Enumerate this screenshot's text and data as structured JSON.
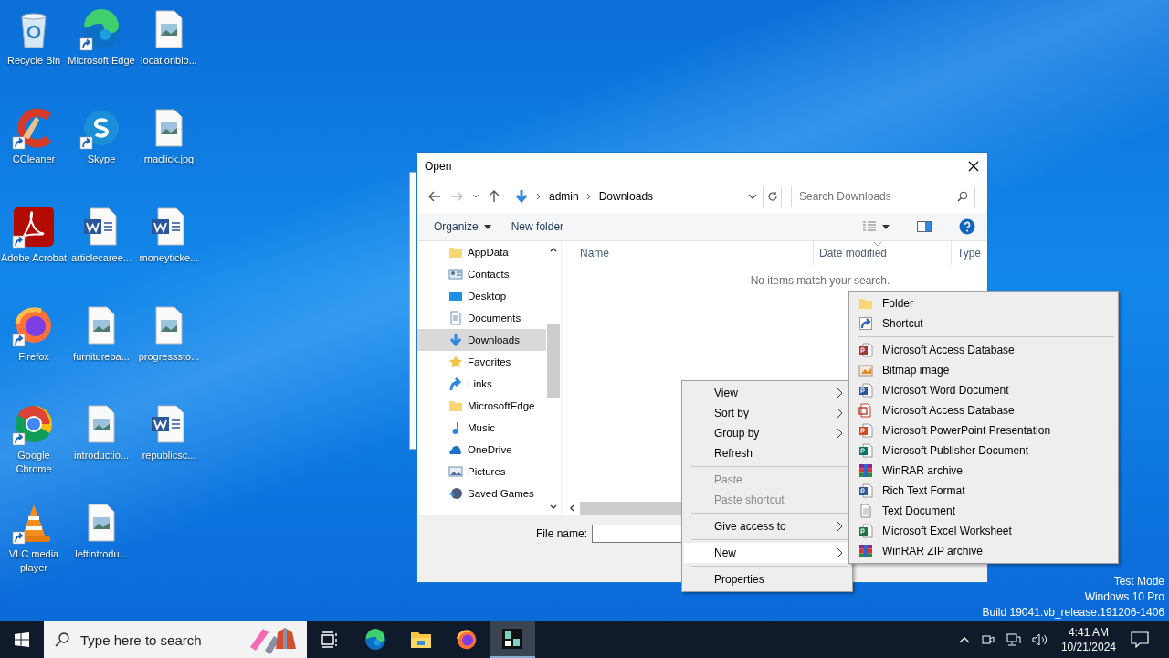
{
  "desktop": {
    "icons": [
      {
        "label": "Recycle Bin",
        "kind": "recycle",
        "shortcut": false
      },
      {
        "label": "Microsoft Edge",
        "kind": "edge",
        "shortcut": true
      },
      {
        "label": "locationblo...",
        "kind": "image",
        "shortcut": false
      },
      {
        "label": "CCleaner",
        "kind": "ccleaner",
        "shortcut": true
      },
      {
        "label": "Skype",
        "kind": "skype",
        "shortcut": true
      },
      {
        "label": "maclick.jpg",
        "kind": "image",
        "shortcut": false
      },
      {
        "label": "Adobe Acrobat",
        "kind": "pdf",
        "shortcut": true
      },
      {
        "label": "articlecaree...",
        "kind": "word",
        "shortcut": false
      },
      {
        "label": "moneyticke...",
        "kind": "word",
        "shortcut": false
      },
      {
        "label": "Firefox",
        "kind": "firefox",
        "shortcut": true
      },
      {
        "label": "furnitureba...",
        "kind": "image",
        "shortcut": false
      },
      {
        "label": "progresssto...",
        "kind": "image",
        "shortcut": false
      },
      {
        "label": "Google Chrome",
        "kind": "chrome",
        "shortcut": true
      },
      {
        "label": "introductio...",
        "kind": "image",
        "shortcut": false
      },
      {
        "label": "republicsc...",
        "kind": "word",
        "shortcut": false
      },
      {
        "label": "VLC media player",
        "kind": "vlc",
        "shortcut": true
      },
      {
        "label": "leftintrodu...",
        "kind": "image",
        "shortcut": false
      }
    ],
    "watermark": [
      "Test Mode",
      "Windows 10 Pro",
      "Build 19041.vb_release.191206-1406"
    ]
  },
  "dialog": {
    "title": "Open",
    "path": [
      "admin",
      "Downloads"
    ],
    "search": {
      "placeholder": "Search Downloads"
    },
    "toolbar": {
      "organize": "Organize",
      "new_folder": "New folder"
    },
    "nav_items": [
      {
        "label": "AppData",
        "kind": "folder",
        "selected": false
      },
      {
        "label": "Contacts",
        "kind": "contacts",
        "selected": false
      },
      {
        "label": "Desktop",
        "kind": "desktop",
        "selected": false
      },
      {
        "label": "Documents",
        "kind": "documents",
        "selected": false
      },
      {
        "label": "Downloads",
        "kind": "downloads",
        "selected": true
      },
      {
        "label": "Favorites",
        "kind": "star",
        "selected": false
      },
      {
        "label": "Links",
        "kind": "link",
        "selected": false
      },
      {
        "label": "MicrosoftEdge",
        "kind": "folder",
        "selected": false
      },
      {
        "label": "Music",
        "kind": "music",
        "selected": false
      },
      {
        "label": "OneDrive",
        "kind": "cloud",
        "selected": false
      },
      {
        "label": "Pictures",
        "kind": "pictures",
        "selected": false
      },
      {
        "label": "Saved Games",
        "kind": "games",
        "selected": false
      }
    ],
    "columns": [
      "Name",
      "Date modified",
      "Type"
    ],
    "empty_message": "No items match your search.",
    "file_name": {
      "label": "File name:"
    }
  },
  "context_menu": [
    {
      "kind": "item",
      "label": "View",
      "disabled": false,
      "submenu": true,
      "selected": false
    },
    {
      "kind": "item",
      "label": "Sort by",
      "disabled": false,
      "submenu": true,
      "selected": false
    },
    {
      "kind": "item",
      "label": "Group by",
      "disabled": false,
      "submenu": true,
      "selected": false
    },
    {
      "kind": "item",
      "label": "Refresh",
      "disabled": false,
      "submenu": false,
      "selected": false
    },
    {
      "kind": "separator"
    },
    {
      "kind": "item",
      "label": "Paste",
      "disabled": true,
      "submenu": false,
      "selected": false
    },
    {
      "kind": "item",
      "label": "Paste shortcut",
      "disabled": true,
      "submenu": false,
      "selected": false
    },
    {
      "kind": "separator"
    },
    {
      "kind": "item",
      "label": "Give access to",
      "disabled": false,
      "submenu": true,
      "selected": false
    },
    {
      "kind": "separator"
    },
    {
      "kind": "item",
      "label": "New",
      "disabled": false,
      "submenu": true,
      "selected": true
    },
    {
      "kind": "separator"
    },
    {
      "kind": "item",
      "label": "Properties",
      "disabled": false,
      "submenu": false,
      "selected": false
    }
  ],
  "new_submenu": [
    {
      "label": "Folder",
      "kind": "folder"
    },
    {
      "label": "Shortcut",
      "kind": "shortcut"
    },
    {
      "kind": "separator"
    },
    {
      "label": "Microsoft Access Database",
      "kind": "access"
    },
    {
      "label": "Bitmap image",
      "kind": "bitmap"
    },
    {
      "label": "Microsoft Word Document",
      "kind": "word"
    },
    {
      "label": "Microsoft Access Database",
      "kind": "redoc"
    },
    {
      "label": "Microsoft PowerPoint Presentation",
      "kind": "ppt"
    },
    {
      "label": "Microsoft Publisher Document",
      "kind": "publisher"
    },
    {
      "label": "WinRAR archive",
      "kind": "rar"
    },
    {
      "label": "Rich Text Format",
      "kind": "word"
    },
    {
      "label": "Text Document",
      "kind": "text"
    },
    {
      "label": "Microsoft Excel Worksheet",
      "kind": "excel"
    },
    {
      "label": "WinRAR ZIP archive",
      "kind": "rar"
    }
  ],
  "taskbar": {
    "search": {
      "placeholder": "Type here to search"
    },
    "apps": [
      {
        "kind": "taskview",
        "active": false
      },
      {
        "kind": "edge",
        "active": false
      },
      {
        "kind": "explorer",
        "active": false
      },
      {
        "kind": "firefox",
        "active": false
      },
      {
        "kind": "app",
        "active": true
      }
    ],
    "time": "4:41 AM",
    "date": "10/21/2024"
  }
}
